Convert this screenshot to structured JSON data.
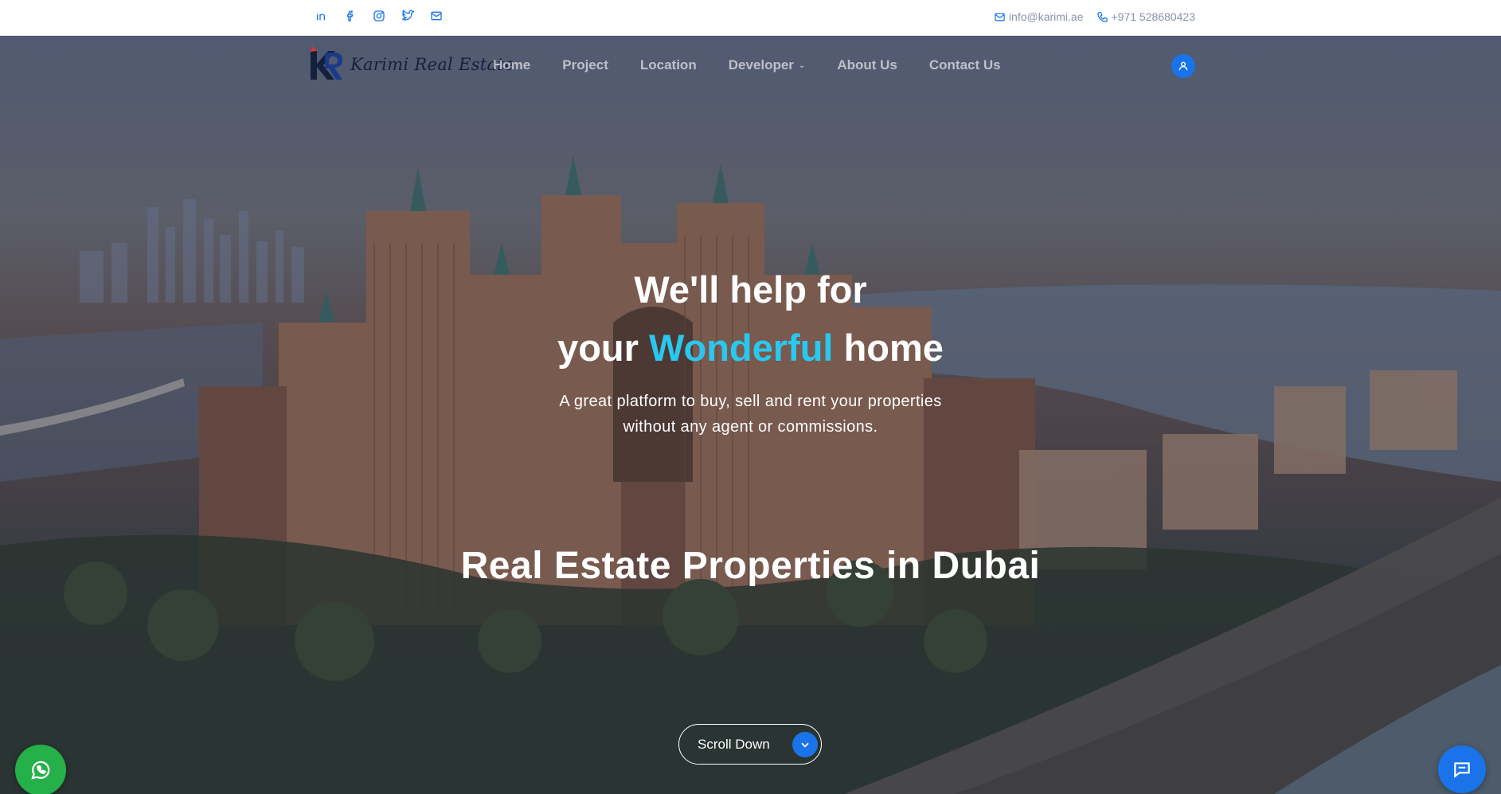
{
  "topbar": {
    "social_icons": [
      "linkedin-icon",
      "facebook-icon",
      "instagram-icon",
      "twitter-icon",
      "mail-icon"
    ],
    "email": "info@karimi.ae",
    "phone": "+971 528680423"
  },
  "nav": {
    "logo_text": "Karimi Real Estate",
    "items": [
      {
        "label": "Home"
      },
      {
        "label": "Project"
      },
      {
        "label": "Location"
      },
      {
        "label": "Developer"
      },
      {
        "label": "About Us"
      },
      {
        "label": "Contact Us"
      }
    ]
  },
  "hero": {
    "title_line1": "We'll help for",
    "title_line2_a": "your",
    "title_line2_accent": "Wonderful",
    "title_line2_b": "home",
    "subtitle_line1": "A great platform to buy, sell and rent your properties",
    "subtitle_line2": "without any agent or commissions.",
    "headline": "Real Estate Properties in Dubai",
    "scroll_label": "Scroll Down"
  },
  "colors": {
    "accent": "#29c8f0",
    "primary": "#1a73e8",
    "whatsapp": "#25b04a",
    "logo_navy": "#14213d",
    "logo_red": "#e2342f"
  }
}
